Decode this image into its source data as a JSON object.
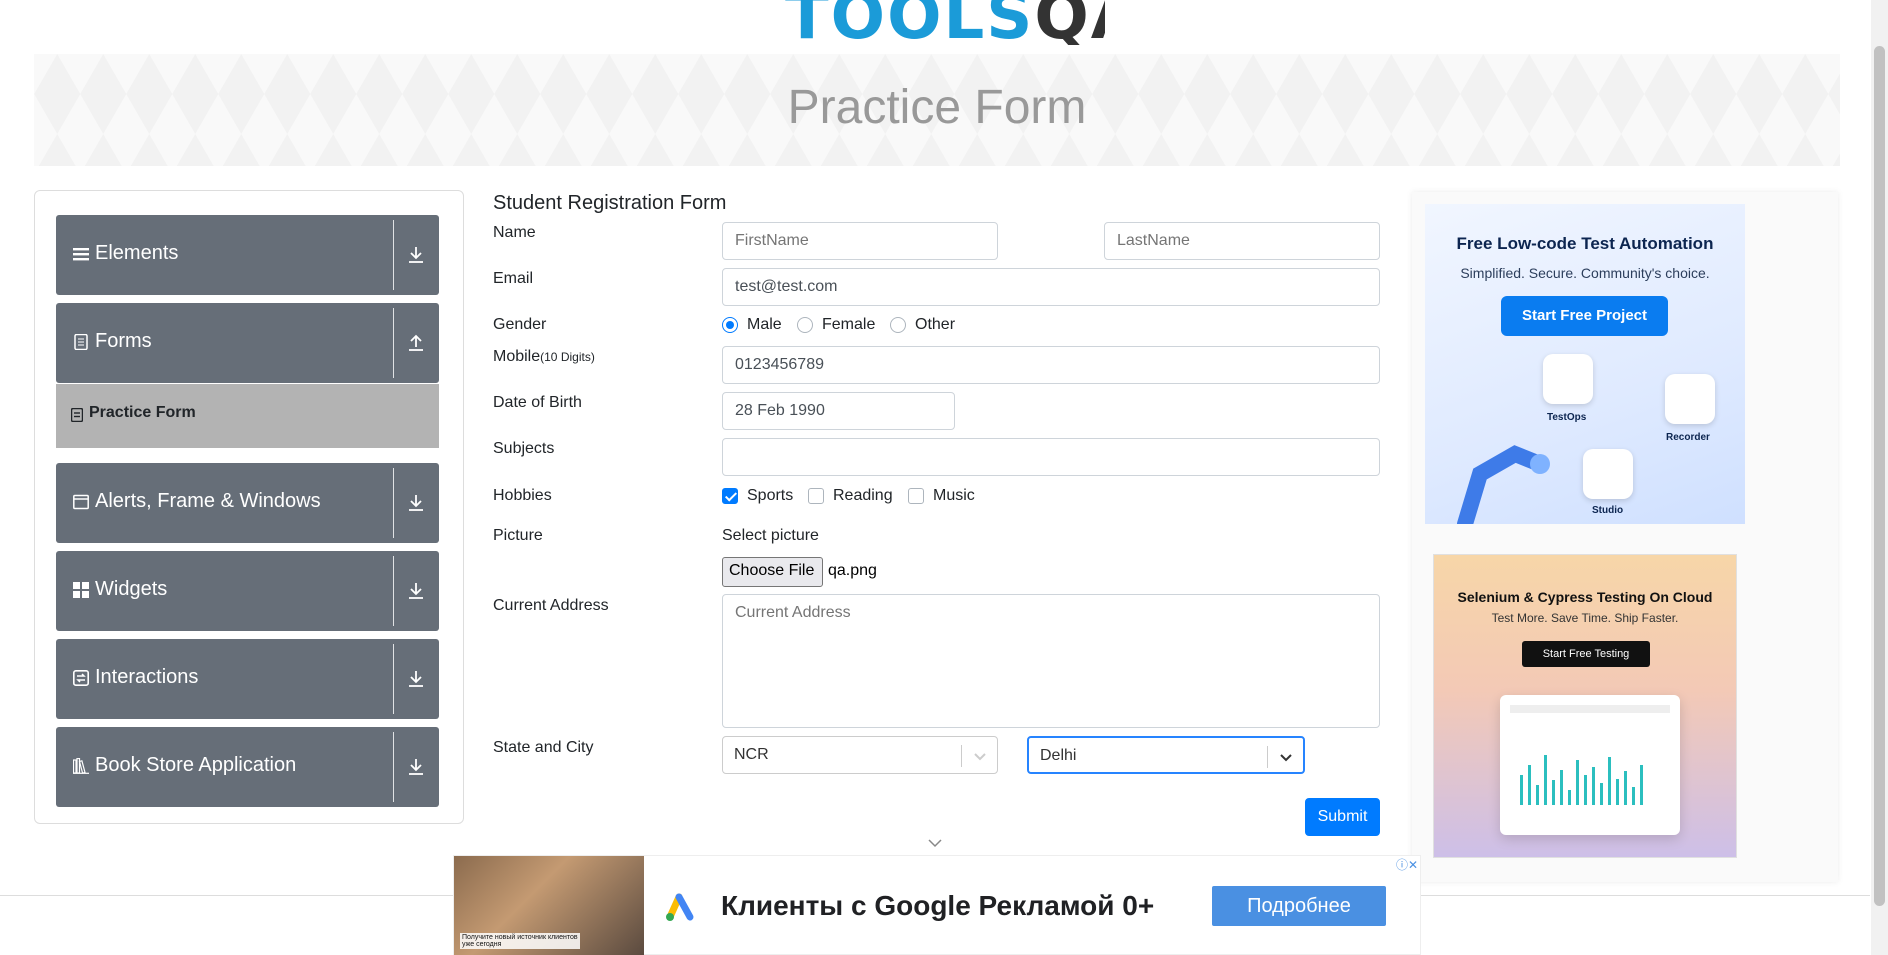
{
  "header": {
    "logo_text": "TOOLS",
    "logo_qa": "QA"
  },
  "banner": {
    "title": "Practice Form"
  },
  "sidebar": {
    "groups": [
      {
        "label": "Elements",
        "icon": "hamburger-icon",
        "toggle": "expand-icon"
      },
      {
        "label": "Forms",
        "icon": "document-icon",
        "toggle": "collapse-icon"
      },
      {
        "label": "Alerts, Frame & Windows",
        "icon": "window-icon",
        "toggle": "expand-icon"
      },
      {
        "label": "Widgets",
        "icon": "widgets-icon",
        "toggle": "expand-icon"
      },
      {
        "label": "Interactions",
        "icon": "interactions-icon",
        "toggle": "expand-icon"
      },
      {
        "label": "Book Store Application",
        "icon": "books-icon",
        "toggle": "expand-icon"
      }
    ],
    "active_item": {
      "label": "Practice Form"
    }
  },
  "form": {
    "title": "Student Registration Form",
    "labels": {
      "name": "Name",
      "email": "Email",
      "gender": "Gender",
      "mobile": "Mobile",
      "mobile_hint": "(10 Digits)",
      "dob": "Date of Birth",
      "subjects": "Subjects",
      "hobbies": "Hobbies",
      "picture": "Picture",
      "address": "Current Address",
      "state_city": "State and City"
    },
    "first_name": {
      "value": "",
      "placeholder": "FirstName"
    },
    "last_name": {
      "value": "",
      "placeholder": "LastName"
    },
    "email": {
      "value": "test@test.com"
    },
    "gender": {
      "options": [
        "Male",
        "Female",
        "Other"
      ],
      "selected": "Male"
    },
    "mobile": {
      "value": "0123456789"
    },
    "dob": {
      "value": "28 Feb 1990"
    },
    "subjects": {
      "value": ""
    },
    "hobbies": {
      "options": [
        "Sports",
        "Reading",
        "Music"
      ],
      "checked": [
        "Sports"
      ]
    },
    "picture": {
      "prompt": "Select picture",
      "button": "Choose File",
      "file": "qa.png"
    },
    "address": {
      "placeholder": "Current Address"
    },
    "state": {
      "value": "NCR"
    },
    "city": {
      "value": "Delhi"
    },
    "submit": "Submit"
  },
  "ads": {
    "ad1": {
      "title": "Free Low-code Test Automation",
      "subtitle": "Simplified. Secure. Community's choice.",
      "cta": "Start Free Project",
      "tiles": [
        "TestOps",
        "Recorder",
        "Studio"
      ]
    },
    "ad2": {
      "title": "Selenium & Cypress Testing On Cloud",
      "subtitle": "Test More. Save Time. Ship Faster.",
      "cta": "Start Free Testing"
    },
    "bottom": {
      "caption": "Получите новый источник клиентов уже сегодня",
      "headline": "Клиенты с Google Рекламой 0+",
      "cta": "Подробнее"
    }
  },
  "colors": {
    "sidebar_bg": "#666e78",
    "active_item_bg": "#b3b3b3",
    "primary": "#007bff",
    "brand": "#1b9bd8"
  }
}
